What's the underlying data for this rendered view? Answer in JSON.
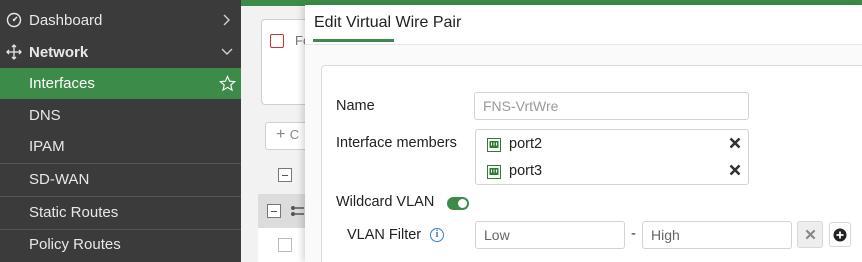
{
  "sidebar": {
    "items": [
      {
        "label": "Dashboard",
        "icon": "dashboard-icon",
        "expander": "chevron-right-icon"
      },
      {
        "label": "Network",
        "icon": "network-icon",
        "expander": "chevron-down-icon"
      },
      {
        "label": "Interfaces",
        "icon": "star-icon"
      },
      {
        "label": "DNS"
      },
      {
        "label": "IPAM"
      },
      {
        "label": "SD-WAN"
      },
      {
        "label": "Static Routes"
      },
      {
        "label": "Policy Routes"
      }
    ]
  },
  "background": {
    "card_text": "Fo",
    "create_button_glyph": "+",
    "create_button_text": "C"
  },
  "dialog": {
    "title": "Edit Virtual Wire Pair",
    "fields": {
      "name_label": "Name",
      "name_placeholder": "FNS-VrtWre",
      "members_label": "Interface members",
      "members": [
        "port2",
        "port3"
      ],
      "wildcard_label": "Wildcard VLAN",
      "wildcard_enabled": true,
      "vlan_filter_label": "VLAN Filter",
      "vlan_low_placeholder": "Low",
      "vlan_separator": "-",
      "vlan_high_placeholder": "High"
    }
  },
  "colors": {
    "accent": "#3d8b48",
    "sidebar_bg": "#3b3b3b",
    "info": "#3b7cc9"
  }
}
